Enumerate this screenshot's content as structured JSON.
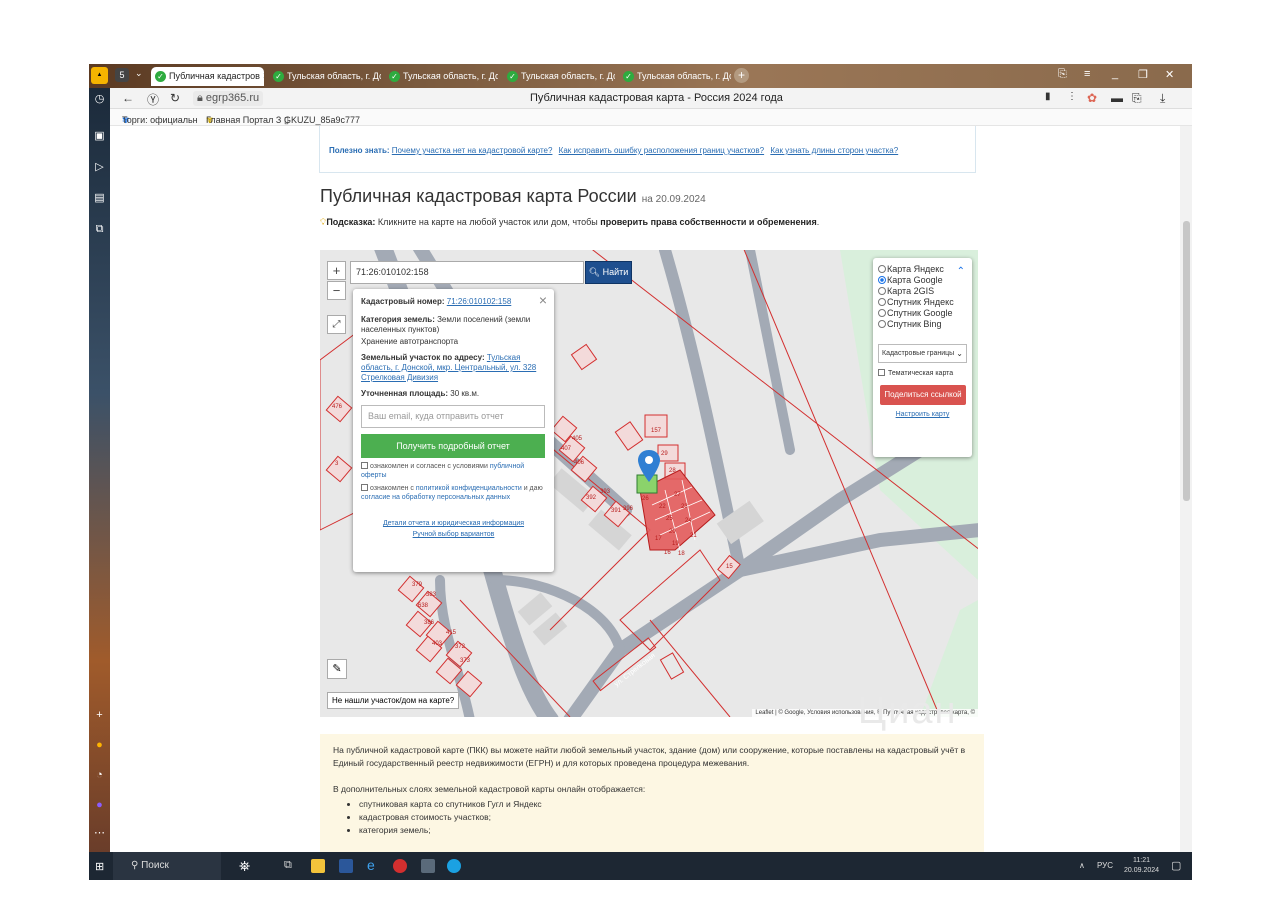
{
  "browser": {
    "badge_count": "5",
    "tabs": [
      {
        "label": "Публичная кадастров",
        "active": true
      },
      {
        "label": "Тульская область, г. Донс",
        "active": false
      },
      {
        "label": "Тульская область, г. Донс",
        "active": false
      },
      {
        "label": "Тульская область, г. Донс",
        "active": false
      },
      {
        "label": "Тульская область, г. Донс",
        "active": false
      }
    ],
    "url": "egrp365.ru",
    "page_title": "Публичная кадастровая карта - Россия 2024 года",
    "bookmarks": [
      "Торги: официальн",
      "Главная Портал З",
      "GKUZU_85a9c777"
    ]
  },
  "page": {
    "useful_prefix": "Полезно знать:",
    "useful_links": [
      "Почему участка нет на кадастровой карте?",
      "Как исправить ошибку расположения границ участков?",
      "Как узнать длины сторон участка?"
    ],
    "heading": "Публичная кадастровая карта России",
    "heading_date": "на 20.09.2024",
    "tip_label": "Подсказка:",
    "tip_text": "Кликните на карте на любой участок или дом, чтобы",
    "tip_bold": "проверить права собственности и обременения",
    "tip_end": "."
  },
  "map": {
    "search_value": "71:26:010102:158",
    "search_button": "Найти",
    "zoom_in": "+",
    "zoom_out": "−",
    "not_found": "Не нашли участок/дом на карте?",
    "attribution": "Leaflet | © Google, Условия использования, © Публичная кадастровая карта, ©",
    "street_label": "ул. Стрелковая",
    "parcel_labels": [
      "157",
      "29",
      "28",
      "27",
      "22",
      "23",
      "25",
      "24",
      "20",
      "21",
      "19",
      "18",
      "17",
      "16",
      "26",
      "393",
      "405",
      "407",
      "406",
      "392",
      "391",
      "396",
      "386",
      "373",
      "372",
      "415",
      "379",
      "638",
      "403",
      "383",
      "476",
      "3",
      "15"
    ],
    "popup": {
      "cad_label": "Кадастровый номер:",
      "cad_value": "71:26:010102:158",
      "cat_label": "Категория земель:",
      "cat_value": "Земли поселений (земли населенных пунктов)",
      "use_value": "Хранение автотранспорта",
      "addr_label": "Земельный участок по адресу:",
      "addr_value": "Тульская область, г. Донской, мкр. Центральный, ул. 328 Стрелковая Дивизия",
      "area_label": "Уточненная площадь:",
      "area_value": "30 кв.м.",
      "email_placeholder": "Ваш email, куда отправить отчет",
      "get_report": "Получить подробный отчет",
      "consent1_a": "ознакомлен и согласен с условиями",
      "consent1_b": "публичной оферты",
      "consent2_a": "ознакомлен с",
      "consent2_b": "политикой конфиденциальности",
      "consent2_c": "и даю",
      "consent2_d": "согласие на обработку персональных данных",
      "link1": "Детали отчета и юридическая информация",
      "link2": "Ручной выбор вариантов"
    },
    "layers": {
      "options": [
        "Карта Яндекс",
        "Карта Google",
        "Карта 2GIS",
        "Спутник Яндекс",
        "Спутник Google",
        "Спутник Bing"
      ],
      "selected": "Карта Google",
      "boundary_select": "Кадастровые границы",
      "thematic": "Тематическая карта",
      "share": "Поделиться ссылкой",
      "configure": "Настроить карту"
    }
  },
  "info": {
    "p1": "На публичной кадастровой карте (ПКК) вы можете найти любой земельный участок, здание (дом) или сооружение, которые поставлены на кадастровый учёт в Единый государственный реестр недвижимости (ЕГРН) и для которых проведена процедура межевания.",
    "p2": "В дополнительных слоях земельной кадастровой карты онлайн отображается:",
    "items": [
      "спутниковая карта со спутников Гугл и Яндекс",
      "кадастровая стоимость участков;",
      "категория земель;"
    ]
  },
  "taskbar": {
    "search": "Поиск",
    "lang": "РУС",
    "time": "11:21",
    "date": "20.09.2024"
  },
  "colors": {
    "parcel_red": "#d32f2f",
    "parcel_fill": "#e35b5b",
    "selected_parcel": "#8bd36b",
    "search_button": "#1e4f8f",
    "get_report": "#4caf50",
    "share": "#d9534f"
  }
}
